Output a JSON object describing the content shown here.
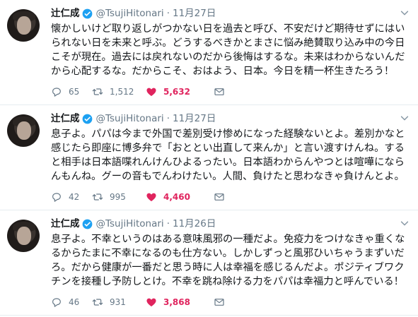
{
  "tweets": [
    {
      "name": "辻仁成",
      "handle": "@TsujiHitonari",
      "dot": "·",
      "date": "11月27日",
      "text": "懐かしいけど取り返しがつかない日を過去と呼び、不安だけど期待せずにはいられない日を未来と呼ぶ。どうするべきかとまさに悩み絶賛取り込み中の今日こそが現在。過去には戻れないのだから後悔はするな。未来はわからないんだから心配するな。だからこそ、おはよう、日本。今日を精一杯生きたろう！",
      "replies": "65",
      "retweets": "1,512",
      "likes": "5,632"
    },
    {
      "name": "辻仁成",
      "handle": "@TsujiHitonari",
      "dot": "·",
      "date": "11月27日",
      "text": "息子よ。パパは今まで外国で差別受け惨めになった経験ないとよ。差別かなと感じたら即座に博多弁で「おととい出直して来んか」と言い渡すけんね。すると相手は日本語喋れんけんひよるったい。日本語わからんやつとは喧嘩にならんもんね。グーの音もでんわけたい。人間、負けたと思わなきゃ負けんとよ。",
      "replies": "42",
      "retweets": "995",
      "likes": "4,460"
    },
    {
      "name": "辻仁成",
      "handle": "@TsujiHitonari",
      "dot": "·",
      "date": "11月26日",
      "text": "息子よ。不幸というのはある意味風邪の一種だよ。免疫力をつけなきゃ重くなるからたまに不幸になるのも仕方ない。しかしずっと風邪ひいちゃうまずいだろ。だから健康が一番だと思う時に人は幸福を感じるんだよ。ポジティブワクチンを接種し予防しとけ。不幸を跳ね除ける力をパパは幸福力と呼んでいる！",
      "replies": "46",
      "retweets": "931",
      "likes": "3,868"
    }
  ],
  "colors": {
    "verified": "#1da1f2",
    "like": "#e0245e",
    "muted": "#657786",
    "divider": "#e6ecf0"
  },
  "icons": [
    "verified-badge-icon",
    "chevron-down-icon",
    "reply-icon",
    "retweet-icon",
    "heart-icon",
    "mail-icon"
  ]
}
